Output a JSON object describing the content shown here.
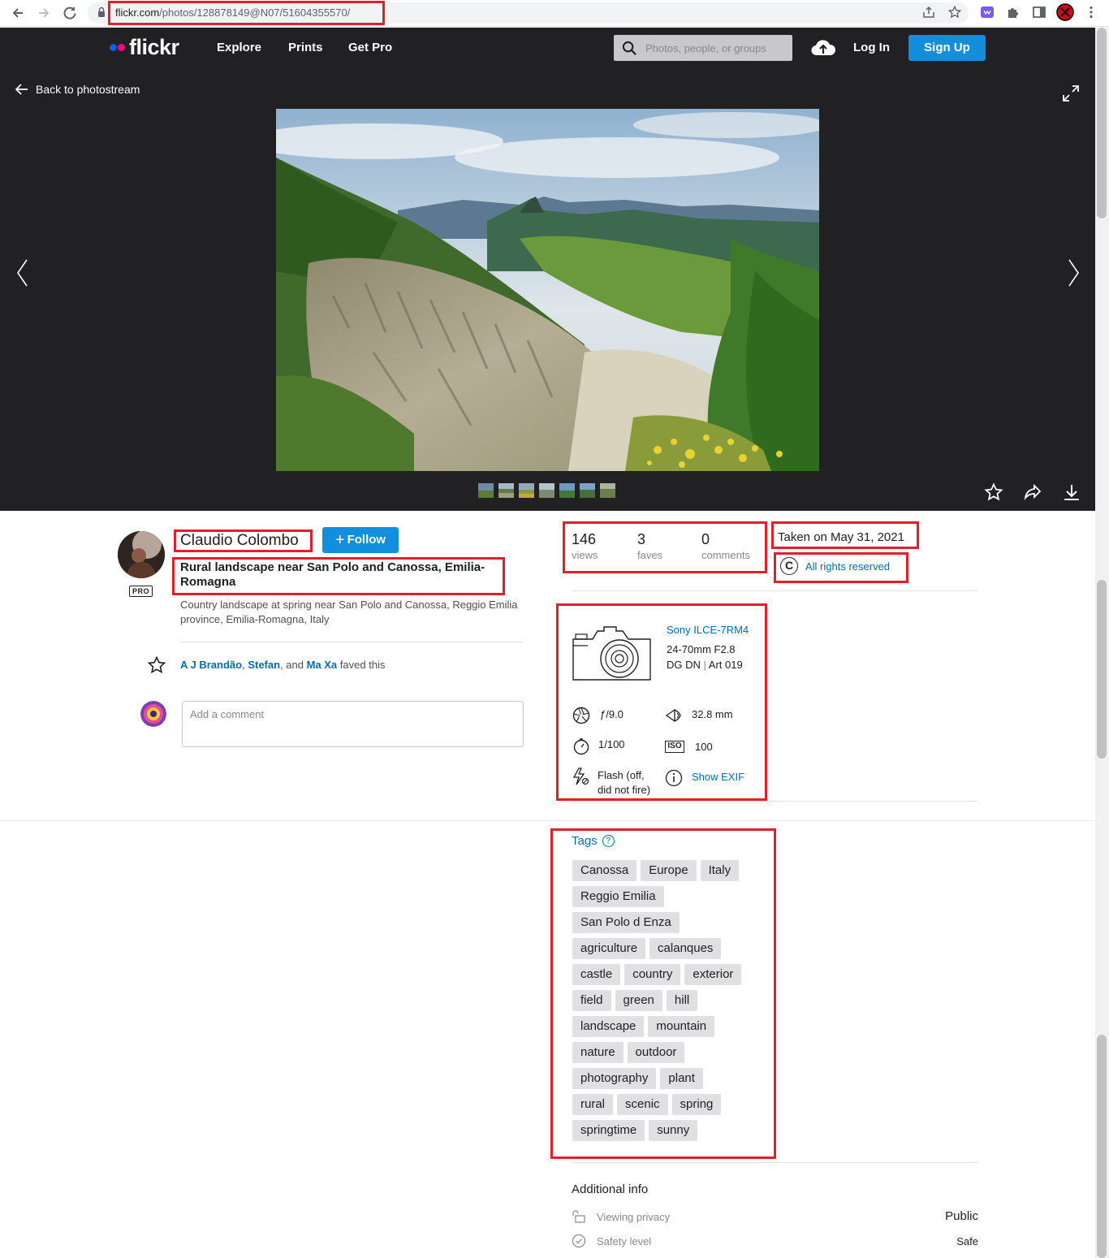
{
  "browser": {
    "url_host": "flickr.com",
    "url_path": "/photos/128878149@N07/51604355570/"
  },
  "header": {
    "logo": "flickr",
    "nav": [
      "Explore",
      "Prints",
      "Get Pro"
    ],
    "search_placeholder": "Photos, people, or groups",
    "login": "Log In",
    "signup": "Sign Up"
  },
  "photo": {
    "back_label": "Back to photostream"
  },
  "author": {
    "name": "Claudio Colombo",
    "badge": "PRO",
    "follow_label": "Follow"
  },
  "photo_info": {
    "title": "Rural landscape near San Polo and Canossa, Emilia-Romagna",
    "description": "Country landscape at spring near San Polo and Canossa, Reggio Emilia province, Emilia-Romagna, Italy"
  },
  "faves": {
    "users": [
      "A J Brandão",
      "Stefan",
      "Ma Xa"
    ],
    "sep1": ", ",
    "sep2": ", and ",
    "suffix": " faved this"
  },
  "comment": {
    "placeholder": "Add a comment"
  },
  "stats": {
    "views": "146",
    "views_label": "views",
    "faves": "3",
    "faves_label": "faves",
    "comments": "0",
    "comments_label": "comments"
  },
  "taken": "Taken on May 31, 2021",
  "rights": "All rights reserved",
  "camera": {
    "model": "Sony ILCE-7RM4",
    "lens_line1": "24-70mm F2.8",
    "lens_line2a": "DG DN",
    "lens_sep": " | ",
    "lens_line2b": "Art 019",
    "aperture": "ƒ/9.0",
    "focal_length": "32.8 mm",
    "shutter": "1/100",
    "iso": "100",
    "iso_label": "ISO",
    "flash_line1": "Flash (off,",
    "flash_line2": "did not fire)",
    "show_exif": "Show EXIF"
  },
  "tags_heading": "Tags",
  "tags": [
    [
      "Canossa",
      "Europe",
      "Italy"
    ],
    [
      "Reggio Emilia"
    ],
    [
      "San Polo d Enza"
    ],
    [
      "agriculture",
      "calanques"
    ],
    [
      "castle",
      "country",
      "exterior"
    ],
    [
      "field",
      "green",
      "hill"
    ],
    [
      "landscape",
      "mountain"
    ],
    [
      "nature",
      "outdoor"
    ],
    [
      "photography",
      "plant"
    ],
    [
      "rural",
      "scenic",
      "spring"
    ],
    [
      "springtime",
      "sunny"
    ]
  ],
  "additional_info": {
    "heading": "Additional info",
    "privacy_label": "Viewing privacy",
    "privacy_value": "Public",
    "safety_label": "Safety level",
    "safety_value": "Safe"
  },
  "colors": {
    "accent_blue": "#128fdc",
    "link_blue": "#006dac",
    "flickr_blue": "#0063dc",
    "flickr_pink": "#ff0084",
    "annotation_red": "#e0202a"
  }
}
